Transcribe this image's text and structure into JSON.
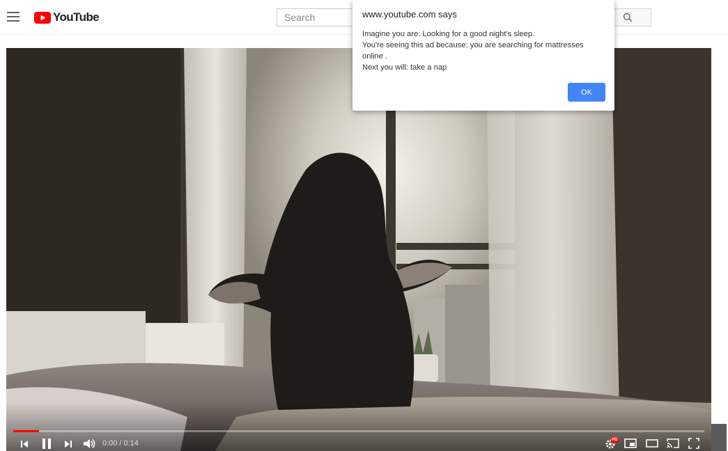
{
  "masthead": {
    "logo_text": "YouTube",
    "search": {
      "placeholder": "Search",
      "value": ""
    }
  },
  "player": {
    "current_time": "0:00",
    "separator": "/",
    "duration": "0:14",
    "progress_fraction": 0.037,
    "hd_badge": "HD"
  },
  "dialog": {
    "title": "www.youtube.com says",
    "lines": [
      "Imagine you are: Looking for a good night's sleep.",
      "You're seeing this ad because: you are searching for mattresses online .",
      "Next you will: take a nap"
    ],
    "ok_label": "OK"
  },
  "icons": {
    "menu": "hamburger-menu-icon",
    "logo": "youtube-play-icon",
    "search": "magnifier-icon",
    "previous": "skip-previous-icon",
    "pause": "pause-icon",
    "next": "skip-next-icon",
    "volume": "volume-icon",
    "settings": "gear-icon",
    "miniplayer": "miniplayer-icon",
    "theater": "theater-mode-icon",
    "cast": "cast-icon",
    "fullscreen": "fullscreen-icon"
  },
  "colors": {
    "brand_red": "#ff0000",
    "dialog_button": "#4285f4",
    "progress_played": "#ff0000"
  }
}
